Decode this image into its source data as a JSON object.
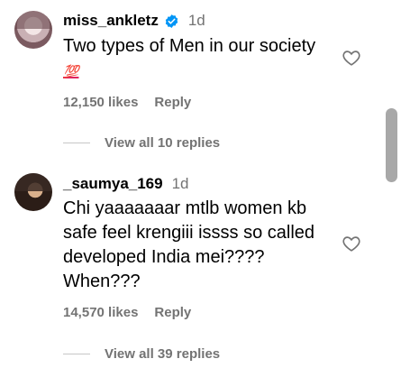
{
  "comments": [
    {
      "username": "miss_ankletz",
      "verified": true,
      "time": "1d",
      "text": "Two types of Men in our society",
      "emoji": "💯",
      "likes": "12,150 likes",
      "reply_label": "Reply",
      "view_replies": "View all 10 replies"
    },
    {
      "username": "_saumya_169",
      "verified": false,
      "time": "1d",
      "text": "Chi yaaaaaaar mtlb women kb safe feel krengiii issss so called developed India mei???? When???",
      "likes": "14,570 likes",
      "reply_label": "Reply",
      "view_replies": "View all 39 replies"
    }
  ],
  "icons": {
    "like": "heart-outline-icon",
    "verified": "verified-badge-icon"
  },
  "colors": {
    "verified_blue": "#0095f6",
    "secondary_text": "#737373",
    "scrollbar_thumb": "#a8a8a8"
  }
}
